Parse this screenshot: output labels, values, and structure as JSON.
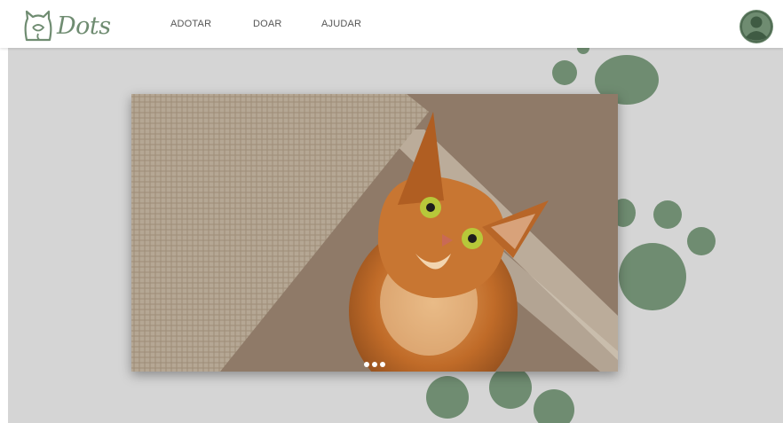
{
  "brand": {
    "name": "Dots"
  },
  "nav": {
    "items": [
      {
        "label": "ADOTAR"
      },
      {
        "label": "DOAR"
      },
      {
        "label": "AJUDAR"
      }
    ]
  },
  "user": {
    "avatar_icon": "user-avatar-icon"
  },
  "carousel": {
    "image": "orange-cat-looking-up",
    "slide_count": 3
  },
  "colors": {
    "accent": "#6f8c71",
    "background": "#d5d5d5",
    "header": "#ffffff"
  }
}
